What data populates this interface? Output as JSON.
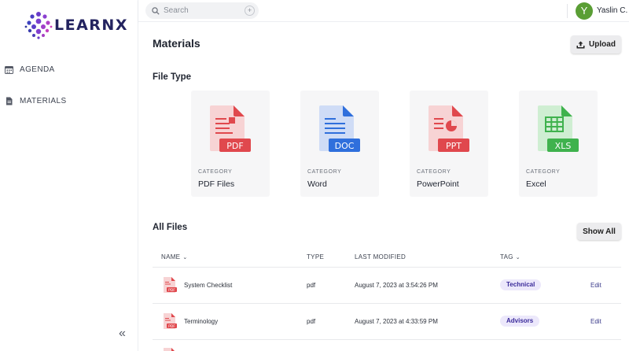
{
  "brand": {
    "name": "LEARNX"
  },
  "sidebar": {
    "items": [
      {
        "label": "AGENDA",
        "icon": "calendar-icon"
      },
      {
        "label": "MATERIALS",
        "icon": "document-icon"
      }
    ],
    "collapse_glyph": "«"
  },
  "topbar": {
    "search_placeholder": "Search",
    "search_add_glyph": "+",
    "user_initial": "Y",
    "user_name": "Yaslin C."
  },
  "page": {
    "title": "Materials",
    "upload_label": "Upload",
    "file_type_title": "File Type",
    "all_files_title": "All Files",
    "show_all_label": "Show All"
  },
  "categories": [
    {
      "label": "CATEGORY",
      "name": "PDF Files",
      "badge": "PDF",
      "color": "#e0484d",
      "light": "#f7d3d4"
    },
    {
      "label": "CATEGORY",
      "name": "Word",
      "badge": "DOC",
      "color": "#2f6fdc",
      "light": "#cfdcf6"
    },
    {
      "label": "CATEGORY",
      "name": "PowerPoint",
      "badge": "PPT",
      "color": "#e0484d",
      "light": "#f7d3d4"
    },
    {
      "label": "CATEGORY",
      "name": "Excel",
      "badge": "XLS",
      "color": "#3fb24d",
      "light": "#cfeed2"
    }
  ],
  "table": {
    "headers": {
      "name": "NAME",
      "type": "TYPE",
      "modified": "LAST MODIFIED",
      "tag": "TAG"
    },
    "rows": [
      {
        "name": "System Checklist",
        "type": "pdf",
        "modified": "August 7, 2023 at 3:54:26 PM",
        "tag": "Technical",
        "action": "Edit"
      },
      {
        "name": "Terminology",
        "type": "pdf",
        "modified": "August 7, 2023 at 4:33:59 PM",
        "tag": "Advisors",
        "action": "Edit"
      }
    ],
    "caret_glyph": "⌄"
  },
  "colors": {
    "accent": "#3a2a9a",
    "avatar": "#5a9e35",
    "pdf_red": "#e0484d"
  }
}
